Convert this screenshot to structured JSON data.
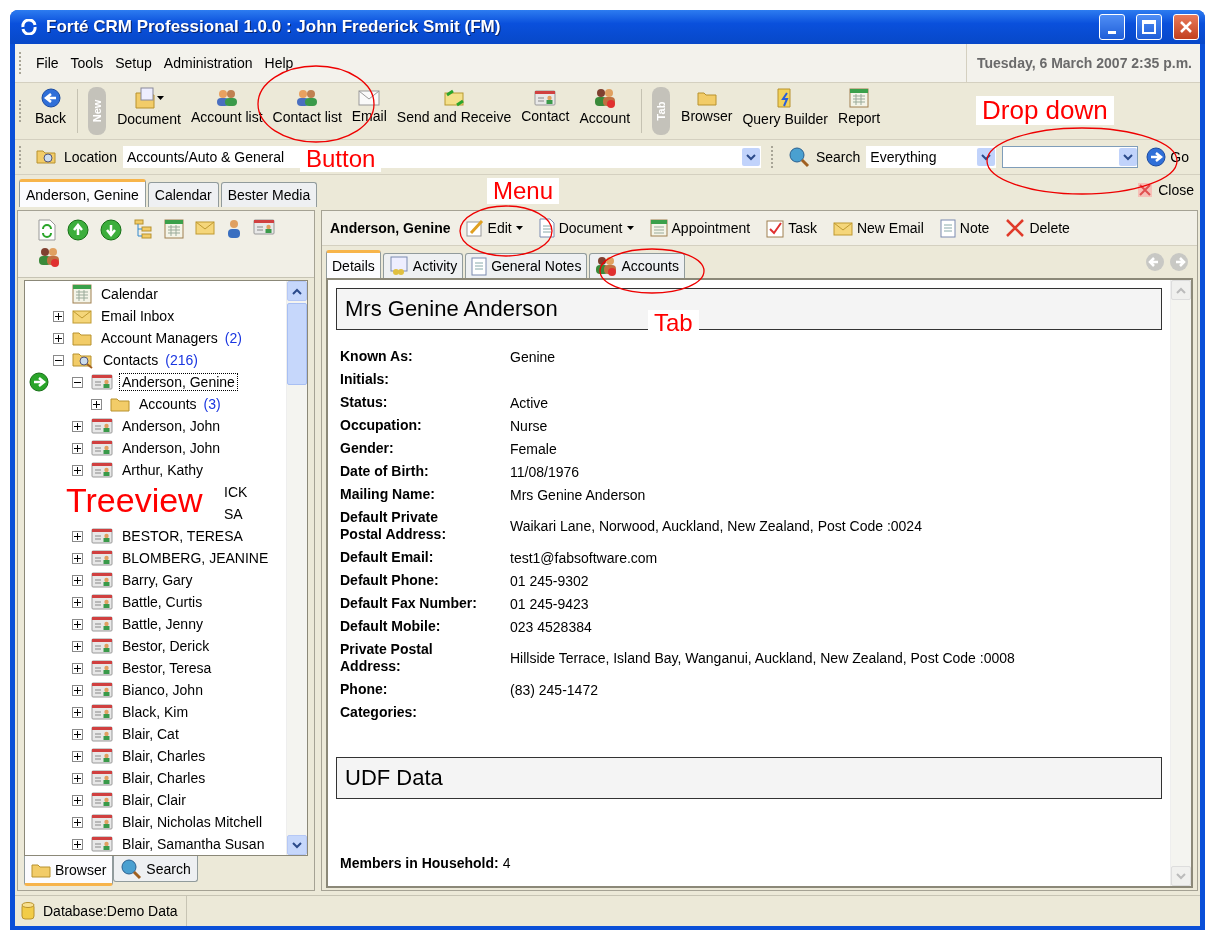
{
  "window": {
    "title": "Forté CRM Professional 1.0.0 : John Frederick Smit (FM)"
  },
  "menu": [
    "File",
    "Tools",
    "Setup",
    "Administration",
    "Help"
  ],
  "datetime": "Tuesday, 6 March 2007 2:35 p.m.",
  "toolbar": [
    {
      "kind": "button",
      "label": "Back"
    },
    {
      "kind": "grip",
      "label": "New"
    },
    {
      "kind": "button",
      "label": "Document",
      "dropdown": true
    },
    {
      "kind": "button",
      "label": "Account list"
    },
    {
      "kind": "button",
      "label": "Contact list"
    },
    {
      "kind": "button",
      "label": "Email"
    },
    {
      "kind": "button",
      "label": "Send and Receive"
    },
    {
      "kind": "button",
      "label": "Contact"
    },
    {
      "kind": "button",
      "label": "Account"
    },
    {
      "kind": "grip",
      "label": "Tab"
    },
    {
      "kind": "button",
      "label": "Browser"
    },
    {
      "kind": "button",
      "label": "Query Builder"
    },
    {
      "kind": "button",
      "label": "Report"
    }
  ],
  "location": {
    "label": "Location",
    "value": "Accounts/Auto & General"
  },
  "search": {
    "label": "Search",
    "scope": "Everything",
    "go": "Go"
  },
  "doc_tabs": [
    {
      "label": "Anderson, Genine",
      "selected": true
    },
    {
      "label": "Calendar",
      "selected": false
    },
    {
      "label": "Bester Media",
      "selected": false
    }
  ],
  "close": "Close",
  "tree": [
    {
      "kind": "calendar",
      "label": "Calendar",
      "selected": false
    },
    {
      "kind": "inbox",
      "label": "Email Inbox",
      "expanded": false,
      "selected": false
    },
    {
      "kind": "folder",
      "label": "Account Managers",
      "count": "(2)",
      "expanded": false,
      "selected": false
    },
    {
      "kind": "search-folder",
      "label": "Contacts",
      "count": "(216)",
      "expanded": true,
      "selected": false,
      "children": [
        {
          "kind": "contact",
          "label": "Anderson, Genine",
          "expanded": true,
          "selected": true,
          "current": true,
          "children": [
            {
              "kind": "folder",
              "label": "Accounts",
              "count": "(3)",
              "expanded": false,
              "selected": false
            }
          ]
        },
        {
          "kind": "contact",
          "label": "Anderson, John",
          "expanded": false,
          "selected": false
        },
        {
          "kind": "contact",
          "label": "Anderson, John",
          "expanded": false,
          "selected": false
        },
        {
          "kind": "contact",
          "label": "Arthur, Kathy",
          "expanded": false,
          "selected": false
        },
        {
          "kind": "covered",
          "label": "ICK"
        },
        {
          "kind": "covered",
          "label": "SA"
        },
        {
          "kind": "contact",
          "label": "BESTOR, TERESA",
          "expanded": false,
          "selected": false
        },
        {
          "kind": "contact",
          "label": "BLOMBERG, JEANINE",
          "expanded": false,
          "selected": false
        },
        {
          "kind": "contact",
          "label": "Barry, Gary",
          "expanded": false,
          "selected": false
        },
        {
          "kind": "contact",
          "label": "Battle, Curtis",
          "expanded": false,
          "selected": false
        },
        {
          "kind": "contact",
          "label": "Battle, Jenny",
          "expanded": false,
          "selected": false
        },
        {
          "kind": "contact",
          "label": "Bestor, Derick",
          "expanded": false,
          "selected": false
        },
        {
          "kind": "contact",
          "label": "Bestor, Teresa",
          "expanded": false,
          "selected": false
        },
        {
          "kind": "contact",
          "label": "Bianco, John",
          "expanded": false,
          "selected": false
        },
        {
          "kind": "contact",
          "label": "Black, Kim",
          "expanded": false,
          "selected": false
        },
        {
          "kind": "contact",
          "label": "Blair, Cat",
          "expanded": false,
          "selected": false
        },
        {
          "kind": "contact",
          "label": "Blair, Charles",
          "expanded": false,
          "selected": false
        },
        {
          "kind": "contact",
          "label": "Blair, Charles",
          "expanded": false,
          "selected": false
        },
        {
          "kind": "contact",
          "label": "Blair, Clair",
          "expanded": false,
          "selected": false
        },
        {
          "kind": "contact",
          "label": "Blair, Nicholas Mitchell",
          "expanded": false,
          "selected": false
        },
        {
          "kind": "contact",
          "label": "Blair, Samantha Susan",
          "expanded": false,
          "selected": false
        }
      ]
    }
  ],
  "panel_tabs": [
    {
      "label": "Browser",
      "selected": true
    },
    {
      "label": "Search",
      "selected": false
    }
  ],
  "contact_toolbar": {
    "title": "Anderson, Genine",
    "buttons": [
      {
        "label": "Edit",
        "dropdown": true
      },
      {
        "label": "Document",
        "dropdown": true
      },
      {
        "label": "Appointment",
        "dropdown": false
      },
      {
        "label": "Task",
        "dropdown": false
      },
      {
        "label": "New Email",
        "dropdown": false
      },
      {
        "label": "Note",
        "dropdown": false
      },
      {
        "label": "Delete",
        "dropdown": false
      }
    ]
  },
  "detail_tabs": [
    {
      "label": "Details",
      "selected": true
    },
    {
      "label": "Activity",
      "selected": false
    },
    {
      "label": "General Notes",
      "selected": false
    },
    {
      "label": "Accounts",
      "selected": false
    }
  ],
  "heading": "Mrs Genine Anderson",
  "fields": [
    {
      "label": "Known As:",
      "value": "Genine"
    },
    {
      "label": "Initials:"
    },
    {
      "label": "Status:",
      "value": "Active"
    },
    {
      "label": "Occupation:",
      "value": "Nurse"
    },
    {
      "label": "Gender:",
      "value": "Female"
    },
    {
      "label": "Date of Birth:",
      "value": "11/08/1976"
    },
    {
      "label": "Mailing Name:",
      "value": "Mrs Genine Anderson"
    },
    {
      "label": "Default Private Postal Address:",
      "value": "Waikari Lane, Norwood, Auckland, New Zealand, Post Code :0024"
    },
    {
      "label": "Default Email:",
      "value": "test1@fabsoftware.com"
    },
    {
      "label": "Default Phone:",
      "value": "01 245-9302"
    },
    {
      "label": "Default Fax Number:",
      "value": "01 245-9423"
    },
    {
      "label": "Default Mobile:",
      "value": "023 4528384"
    },
    {
      "label": "Private Postal Address:",
      "value": "Hillside Terrace, Island Bay, Wanganui, Auckland, New Zealand, Post Code :0008"
    },
    {
      "label": "Phone:",
      "value": "(83) 245-1472"
    },
    {
      "label": "Categories:"
    }
  ],
  "udf": {
    "heading": "UDF Data",
    "label": "Members in Household:",
    "value": "4"
  },
  "status_bar": "Database:Demo Data",
  "annotations": [
    "Button",
    "Menu",
    "Tab",
    "Drop down",
    "Treeview"
  ]
}
